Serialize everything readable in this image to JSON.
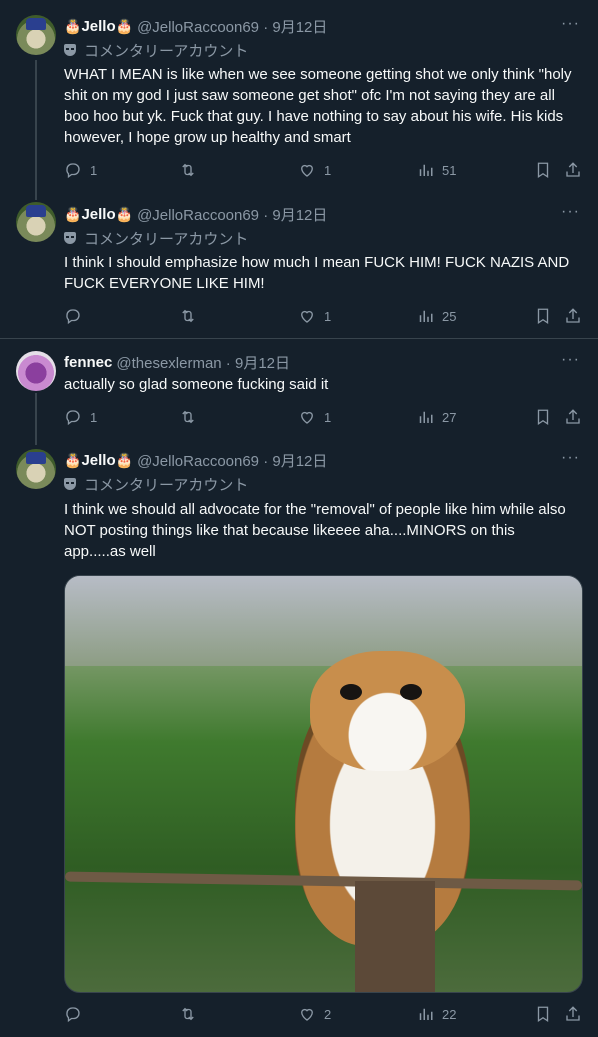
{
  "colors": {
    "background": "#15202b",
    "text": "#f7f9f9",
    "muted": "#8b98a5",
    "border": "#38444d"
  },
  "tweets": [
    {
      "name": "Jello",
      "decoration": "🎂",
      "handle": "@JelloRaccoon69",
      "date": "9月12日",
      "label": "コメンタリーアカウント",
      "text": "WHAT I MEAN is like when we see someone getting shot we only think \"holy shit on my god I just saw someone get shot\" ofc I'm not saying they are all boo hoo but yk. Fuck that guy. I have nothing to say about his wife. His kids however, I hope grow up healthy and smart",
      "replies": "1",
      "retweets": "",
      "likes": "1",
      "views": "51"
    },
    {
      "name": "Jello",
      "decoration": "🎂",
      "handle": "@JelloRaccoon69",
      "date": "9月12日",
      "label": "コメンタリーアカウント",
      "text": "I think I should emphasize how much I mean FUCK HIM! FUCK NAZIS AND FUCK EVERYONE LIKE HIM!",
      "replies": "",
      "retweets": "",
      "likes": "1",
      "views": "25"
    },
    {
      "name": "fennec",
      "handle": "@thesexlerman",
      "date": "9月12日",
      "text": "actually so glad someone fucking said it",
      "replies": "1",
      "retweets": "",
      "likes": "1",
      "views": "27"
    },
    {
      "name": "Jello",
      "decoration": "🎂",
      "handle": "@JelloRaccoon69",
      "date": "9月12日",
      "label": "コメンタリーアカウント",
      "text": "I think we should all advocate for the \"removal\" of people like him while also NOT posting things like that because likeeee aha....MINORS on this app.....as well",
      "replies": "",
      "retweets": "",
      "likes": "2",
      "views": "22"
    }
  ],
  "icons": {
    "more": "more-dots-icon",
    "reply": "reply-icon",
    "retweet": "retweet-icon",
    "like": "heart-icon",
    "views": "views-icon",
    "bookmark": "bookmark-icon",
    "share": "share-icon"
  },
  "more_glyph": "···",
  "separator": " · "
}
